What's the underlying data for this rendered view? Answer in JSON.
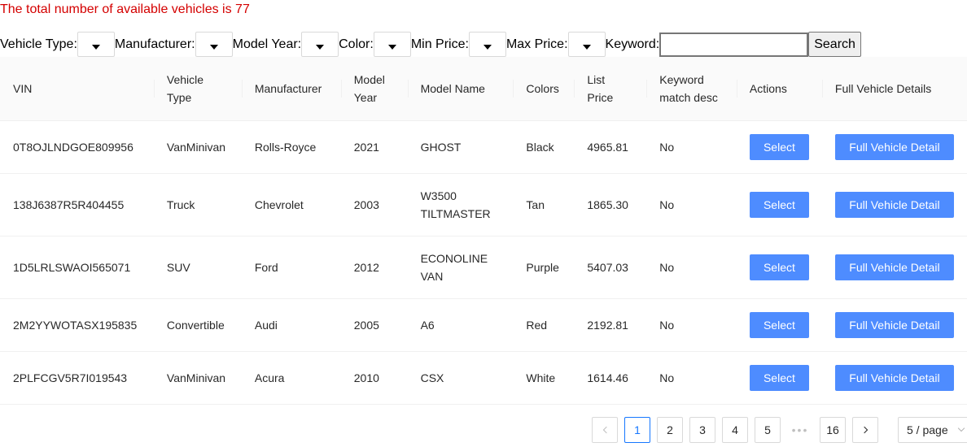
{
  "summary": {
    "total_text": "The total number of available vehicles is 77"
  },
  "filters": {
    "vehicle_type_label": "Vehicle Type:",
    "manufacturer_label": "Manufacturer:",
    "model_year_label": "Model Year:",
    "color_label": "Color:",
    "min_price_label": "Min Price:",
    "max_price_label": "Max Price:",
    "keyword_label": "Keyword:",
    "keyword_value": "",
    "search_label": "Search"
  },
  "table": {
    "headers": {
      "vin": "VIN",
      "vehicle_type": "Vehicle Type",
      "manufacturer": "Manufacturer",
      "model_year": "Model Year",
      "model_name": "Model Name",
      "colors": "Colors",
      "list_price": "List Price",
      "keyword_match": "Keyword match desc",
      "actions": "Actions",
      "full_details": "Full Vehicle Details"
    },
    "select_label": "Select",
    "full_detail_label": "Full Vehicle Detail",
    "rows": [
      {
        "vin": "0T8OJLNDGOE809956",
        "vehicle_type": "VanMinivan",
        "manufacturer": "Rolls-Royce",
        "model_year": "2021",
        "model_name": "GHOST",
        "colors": "Black",
        "list_price": "4965.81",
        "keyword_match": "No"
      },
      {
        "vin": "138J6387R5R404455",
        "vehicle_type": "Truck",
        "manufacturer": "Chevrolet",
        "model_year": "2003",
        "model_name": "W3500 TILTMASTER",
        "colors": "Tan",
        "list_price": "1865.30",
        "keyword_match": "No"
      },
      {
        "vin": "1D5LRLSWAOI565071",
        "vehicle_type": "SUV",
        "manufacturer": "Ford",
        "model_year": "2012",
        "model_name": "ECONOLINE VAN",
        "colors": "Purple",
        "list_price": "5407.03",
        "keyword_match": "No"
      },
      {
        "vin": "2M2YYWOTASX195835",
        "vehicle_type": "Convertible",
        "manufacturer": "Audi",
        "model_year": "2005",
        "model_name": "A6",
        "colors": "Red",
        "list_price": "2192.81",
        "keyword_match": "No"
      },
      {
        "vin": "2PLFCGV5R7I019543",
        "vehicle_type": "VanMinivan",
        "manufacturer": "Acura",
        "model_year": "2010",
        "model_name": "CSX",
        "colors": "White",
        "list_price": "1614.46",
        "keyword_match": "No"
      }
    ]
  },
  "pagination": {
    "pages": [
      "1",
      "2",
      "3",
      "4",
      "5"
    ],
    "current": "1",
    "ellipsis": "•••",
    "last": "16",
    "page_size": "5 / page"
  },
  "colors": {
    "accent": "#4e8cff",
    "total_text": "#d40000",
    "active_page": "#1677ff"
  }
}
